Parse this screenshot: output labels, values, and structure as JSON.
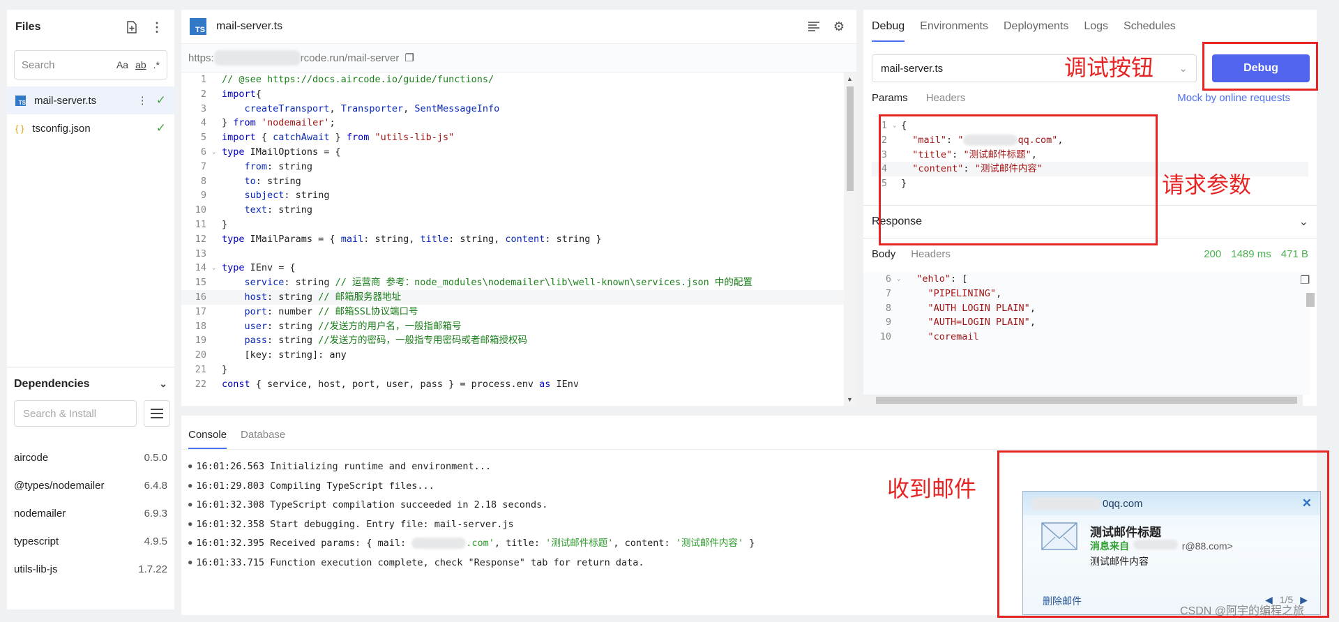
{
  "files": {
    "title": "Files",
    "search_placeholder": "Search",
    "search_opts": [
      "Aa",
      "ab",
      ".*"
    ],
    "items": [
      {
        "name": "mail-server.ts",
        "type": "ts"
      },
      {
        "name": "tsconfig.json",
        "type": "json"
      }
    ]
  },
  "dependencies": {
    "title": "Dependencies",
    "search_placeholder": "Search & Install",
    "items": [
      {
        "name": "aircode",
        "version": "0.5.0"
      },
      {
        "name": "@types/nodemailer",
        "version": "6.4.8"
      },
      {
        "name": "nodemailer",
        "version": "6.9.3"
      },
      {
        "name": "typescript",
        "version": "4.9.5"
      },
      {
        "name": "utils-lib-js",
        "version": "1.7.22"
      }
    ]
  },
  "editor": {
    "tab_label": "mail-server.ts",
    "ts_badge": "TS",
    "url_prefix": "https:",
    "url_suffix": "rcode.run/mail-server",
    "lines": [
      [
        [
          "cm",
          "// @see https://docs.aircode.io/guide/functions/"
        ]
      ],
      [
        [
          "kw",
          "import"
        ],
        [
          "",
          "{"
        ]
      ],
      [
        [
          "",
          "    "
        ],
        [
          "pr",
          "createTransport"
        ],
        [
          "",
          ", "
        ],
        [
          "pr",
          "Transporter"
        ],
        [
          "",
          ", "
        ],
        [
          "pr",
          "SentMessageInfo"
        ]
      ],
      [
        [
          "",
          "} "
        ],
        [
          "kw",
          "from"
        ],
        [
          "",
          " "
        ],
        [
          "st",
          "'nodemailer'"
        ],
        [
          "",
          ";"
        ]
      ],
      [
        [
          "kw",
          "import"
        ],
        [
          "",
          " { "
        ],
        [
          "pr",
          "catchAwait"
        ],
        [
          "",
          " } "
        ],
        [
          "kw",
          "from"
        ],
        [
          "",
          " "
        ],
        [
          "st",
          "\"utils-lib-js\""
        ]
      ],
      [
        [
          "kw",
          "type"
        ],
        [
          "",
          " IMailOptions = {"
        ]
      ],
      [
        [
          "",
          "    "
        ],
        [
          "pr",
          "from"
        ],
        [
          "",
          ": string"
        ]
      ],
      [
        [
          "",
          "    "
        ],
        [
          "pr",
          "to"
        ],
        [
          "",
          ": string"
        ]
      ],
      [
        [
          "",
          "    "
        ],
        [
          "pr",
          "subject"
        ],
        [
          "",
          ": string"
        ]
      ],
      [
        [
          "",
          "    "
        ],
        [
          "pr",
          "text"
        ],
        [
          "",
          ": string"
        ]
      ],
      [
        [
          "",
          "}"
        ]
      ],
      [
        [
          "kw",
          "type"
        ],
        [
          "",
          " IMailParams = { "
        ],
        [
          "pr",
          "mail"
        ],
        [
          "",
          ": string, "
        ],
        [
          "pr",
          "title"
        ],
        [
          "",
          ": string, "
        ],
        [
          "pr",
          "content"
        ],
        [
          "",
          ": string }"
        ]
      ],
      [
        [
          "",
          ""
        ]
      ],
      [
        [
          "kw",
          "type"
        ],
        [
          "",
          " IEnv = {"
        ]
      ],
      [
        [
          "",
          "    "
        ],
        [
          "pr",
          "service"
        ],
        [
          "",
          ": string "
        ],
        [
          "cm",
          "// 运营商 参考：node_modules\\nodemailer\\lib\\well-known\\services.json 中的配置"
        ]
      ],
      [
        [
          "",
          "    "
        ],
        [
          "pr",
          "host"
        ],
        [
          "",
          ": string "
        ],
        [
          "cm",
          "// 邮箱服务器地址"
        ]
      ],
      [
        [
          "",
          "    "
        ],
        [
          "pr",
          "port"
        ],
        [
          "",
          ": number "
        ],
        [
          "cm",
          "// 邮箱SSL协议端口号"
        ]
      ],
      [
        [
          "",
          "    "
        ],
        [
          "pr",
          "user"
        ],
        [
          "",
          ": string "
        ],
        [
          "cm",
          "//发送方的用户名，一般指邮箱号"
        ]
      ],
      [
        [
          "",
          "    "
        ],
        [
          "pr",
          "pass"
        ],
        [
          "",
          ": string "
        ],
        [
          "cm",
          "//发送方的密码，一般指专用密码或者邮箱授权码"
        ]
      ],
      [
        [
          "",
          "    [key: string]: any"
        ]
      ],
      [
        [
          "",
          "}"
        ]
      ],
      [
        [
          "kw",
          "const"
        ],
        [
          "",
          " { service, host, port, user, pass } = process.env "
        ],
        [
          "kw",
          "as"
        ],
        [
          "",
          " IEnv"
        ]
      ]
    ]
  },
  "debug": {
    "tabs": [
      "Debug",
      "Environments",
      "Deployments",
      "Logs",
      "Schedules"
    ],
    "file_select": "mail-server.ts",
    "debug_button": "Debug",
    "params_tabs": [
      "Params",
      "Headers"
    ],
    "mock_link": "Mock by online requests",
    "params_lines": [
      [
        [
          "",
          "{"
        ]
      ],
      [
        [
          "",
          "  "
        ],
        [
          "st",
          "\"mail\""
        ],
        [
          "",
          ": "
        ],
        [
          "st",
          "\""
        ],
        [
          "blur",
          ""
        ],
        [
          "st",
          "qq.com\""
        ],
        [
          "",
          ","
        ]
      ],
      [
        [
          "",
          "  "
        ],
        [
          "st",
          "\"title\""
        ],
        [
          "",
          ": "
        ],
        [
          "st",
          "\"测试邮件标题\""
        ],
        [
          "",
          ","
        ]
      ],
      [
        [
          "",
          "  "
        ],
        [
          "st",
          "\"content\""
        ],
        [
          "",
          ": "
        ],
        [
          "st",
          "\"测试邮件内容\""
        ]
      ],
      [
        [
          "",
          "}"
        ]
      ]
    ],
    "response_title": "Response",
    "body_tabs": [
      "Body",
      "Headers"
    ],
    "status": "200",
    "time": "1489 ms",
    "size": "471 B",
    "response_lines": [
      {
        "n": "6",
        "t": [
          [
            "",
            "  "
          ],
          [
            "st",
            "\"ehlo\""
          ],
          [
            "",
            ": ["
          ]
        ]
      },
      {
        "n": "7",
        "t": [
          [
            "",
            "    "
          ],
          [
            "st",
            "\"PIPELINING\""
          ],
          [
            "",
            ","
          ]
        ]
      },
      {
        "n": "8",
        "t": [
          [
            "",
            "    "
          ],
          [
            "st",
            "\"AUTH LOGIN PLAIN\""
          ],
          [
            "",
            ","
          ]
        ]
      },
      {
        "n": "9",
        "t": [
          [
            "",
            "    "
          ],
          [
            "st",
            "\"AUTH=LOGIN PLAIN\""
          ],
          [
            "",
            ","
          ]
        ]
      },
      {
        "n": "10",
        "t": [
          [
            "",
            "    "
          ],
          [
            "st",
            "\"coremail"
          ]
        ]
      }
    ]
  },
  "console": {
    "tabs": [
      "Console",
      "Database"
    ],
    "logs": [
      [
        [
          "",
          "16:01:26.563 Initializing runtime and environment..."
        ]
      ],
      [
        [
          "",
          "16:01:29.803 Compiling TypeScript files..."
        ]
      ],
      [
        [
          "",
          "16:01:32.308 TypeScript compilation succeeded in 2.18 seconds."
        ]
      ],
      [
        [
          "",
          "16:01:32.358 Start debugging. Entry file: mail-server.js"
        ]
      ],
      [
        [
          "",
          "16:01:32.395 Received params: { mail: "
        ],
        [
          "blur",
          ""
        ],
        [
          "gs",
          ".com'"
        ],
        [
          "",
          ", title: "
        ],
        [
          "gs",
          "'测试邮件标题'"
        ],
        [
          "",
          ", content: "
        ],
        [
          "gs",
          "'测试邮件内容'"
        ],
        [
          "",
          " }"
        ]
      ],
      [
        [
          "",
          "16:01:33.715 Function execution complete, check \"Response\" tab for return data."
        ]
      ]
    ]
  },
  "annotations": {
    "debug_btn": "调试按钮",
    "params": "请求参数",
    "mail": "收到邮件"
  },
  "notification": {
    "account": "0qq.com",
    "title": "测试邮件标题",
    "from_label": "消息来自",
    "from_addr": "r@88.com>",
    "content": "测试邮件内容",
    "delete": "删除邮件",
    "page": "1/5"
  },
  "watermark": "CSDN @阿宇的编程之旅",
  "colors": {
    "accent": "#5064ee",
    "annotation": "#e52424",
    "string": "#a31515",
    "comment": "#1a7f1a",
    "keyword": "#0000c8"
  }
}
